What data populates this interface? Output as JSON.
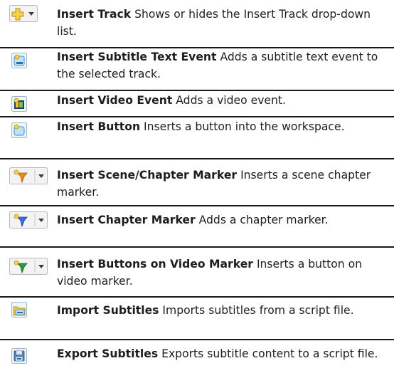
{
  "rows": [
    {
      "title": "Insert Track",
      "text": "Shows or hides the Insert Track drop-down list.",
      "icon": "insert-track-dropdown-icon"
    },
    {
      "title": "Insert Subtitle Text Event",
      "text": "Adds a subtitle text event to the selected track.",
      "icon": "insert-subtitle-text-event-icon"
    },
    {
      "title": "Insert Video Event",
      "text": "Adds a video event.",
      "icon": "insert-video-event-icon"
    },
    {
      "title": "Insert Button",
      "text": "Inserts a button into the workspace.",
      "icon": "insert-button-icon"
    },
    {
      "title": "Insert Scene/Chapter Marker",
      "text": "Inserts a scene chapter marker.",
      "icon": "insert-scene-chapter-marker-icon"
    },
    {
      "title": "Insert Chapter Marker",
      "text": "Adds a chapter marker.",
      "icon": "insert-chapter-marker-icon"
    },
    {
      "title": "Insert Buttons on Video Marker",
      "text": "Inserts a button on video marker.",
      "icon": "insert-buttons-on-video-marker-icon"
    },
    {
      "title": "Import Subtitles",
      "text": "Imports subtitles from a script file.",
      "icon": "import-subtitles-icon"
    },
    {
      "title": "Export Subtitles",
      "text": "Exports subtitle content to a script file.",
      "icon": "export-subtitles-icon"
    }
  ],
  "colors": {
    "rule": "#1a1a1a",
    "marker_orange": "#e98a1c",
    "marker_blue": "#3b6fd8",
    "marker_green": "#2f9a3a",
    "icon_blue": "#4aa0dc"
  }
}
